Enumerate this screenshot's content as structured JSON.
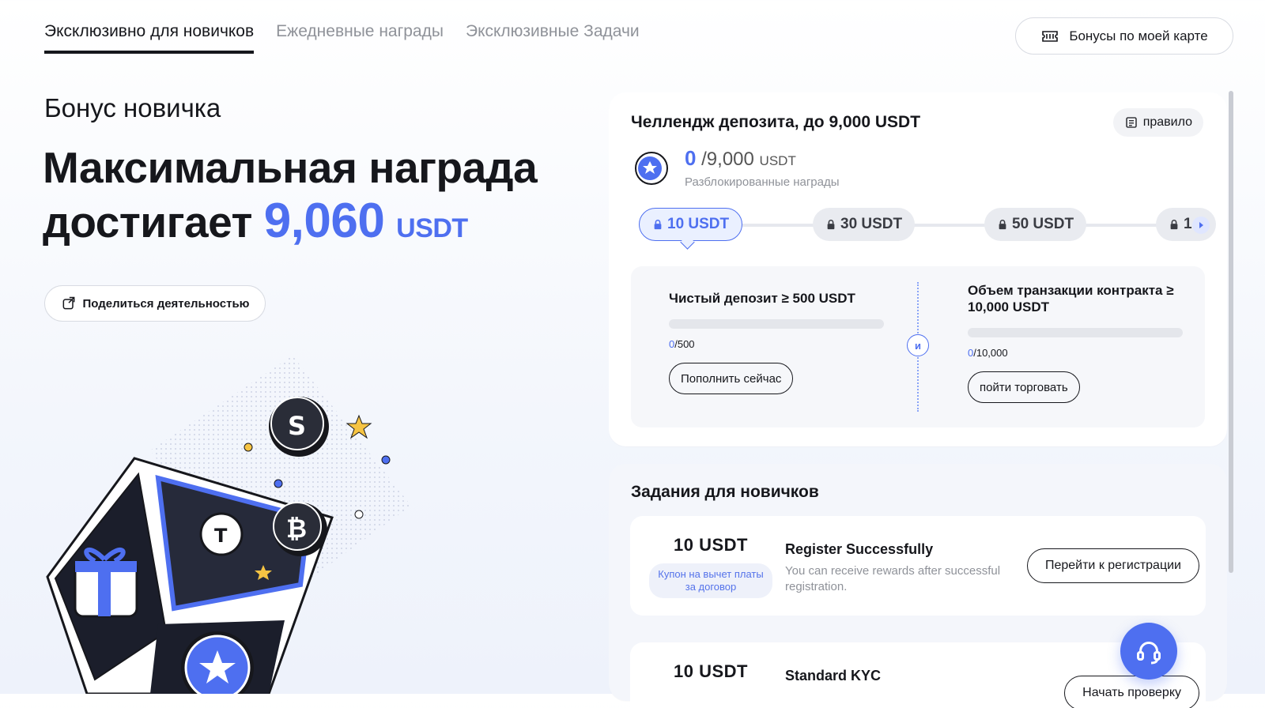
{
  "tabs": [
    {
      "label": "Эксклюзивно для новичков",
      "active": true
    },
    {
      "label": "Ежедневные награды",
      "active": false
    },
    {
      "label": "Эксклюзивные Задачи",
      "active": false
    }
  ],
  "card_bonus_button": "Бонусы по моей карте",
  "hero": {
    "subtitle": "Бонус новичка",
    "line1": "Максимальная награда",
    "line2_prefix": "достигает",
    "amount": "9,060",
    "unit": "USDT",
    "share_button": "Поделиться деятельностью"
  },
  "deposit": {
    "title": "Челлендж депозита, до 9,000 USDT",
    "rule_button": "правило",
    "progress_current": "0",
    "progress_max": "/9,000",
    "progress_unit": "USDT",
    "progress_caption": "Разблокированные награды",
    "milestones": [
      "10 USDT",
      "30 USDT",
      "50 USDT",
      "1"
    ],
    "conditions": [
      {
        "title": "Чистый депозит ≥ 500 USDT",
        "current": "0",
        "target": "/500",
        "button": "Пополнить сейчас"
      },
      {
        "title": "Объем транзакции контракта ≥ 10,000 USDT",
        "current": "0",
        "target": "/10,000",
        "button": "пойти торговать"
      }
    ],
    "and_label": "и"
  },
  "tasks": {
    "title": "Задания для новичков",
    "items": [
      {
        "amount": "10  USDT",
        "tag": "Купон на вычет платы за договор",
        "name": "Register Successfully",
        "desc": "You can receive rewards after successful registration.",
        "button": "Перейти к регистрации"
      },
      {
        "amount": "10  USDT",
        "tag": "",
        "name": "Standard KYC",
        "desc": "",
        "button": "Начать проверку"
      }
    ]
  },
  "colors": {
    "accent": "#4e6ff0",
    "text": "#16171c",
    "muted": "#8f9299"
  }
}
